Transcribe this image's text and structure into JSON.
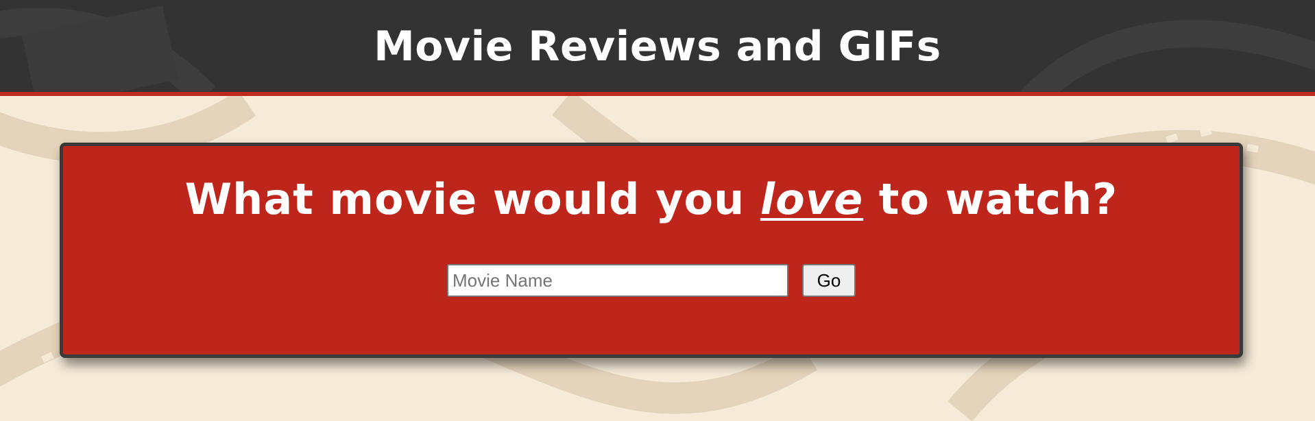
{
  "header": {
    "title": "Movie Reviews and GIFs"
  },
  "search_card": {
    "heading_before": "What movie would you ",
    "heading_emphasis": "love",
    "heading_after": " to watch?",
    "input_placeholder": "Movie Name",
    "input_value": "",
    "go_label": "Go"
  },
  "colors": {
    "header_bg": "#333333",
    "accent_red": "#be261c",
    "page_bg": "#f6ebd9",
    "card_border": "#3a3a3a"
  },
  "icons": {
    "background": "film-strip-background"
  }
}
